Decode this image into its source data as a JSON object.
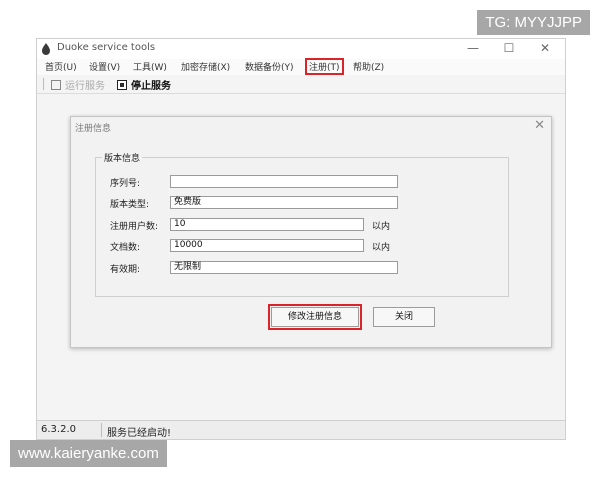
{
  "window": {
    "title": "Duoke service tools",
    "controls": {
      "minimize": "—",
      "maximize": "☐",
      "close": "✕"
    }
  },
  "menu": {
    "items": [
      {
        "label": "首页(U)"
      },
      {
        "label": "设置(V)"
      },
      {
        "label": "工具(W)"
      },
      {
        "label": "加密存储(X)"
      },
      {
        "label": "数据备份(Y)"
      },
      {
        "label": "注册(T)",
        "highlighted": true
      },
      {
        "label": "帮助(Z)"
      }
    ]
  },
  "toolbar": {
    "run_service": "运行服务",
    "stop_service": "停止服务"
  },
  "dialog": {
    "title": "注册信息",
    "close_icon": "✕",
    "group_title": "版本信息",
    "fields": {
      "serial_label": "序列号:",
      "serial_value": "",
      "edition_label": "版本类型:",
      "edition_value": "免费版",
      "users_label": "注册用户数:",
      "users_value": "10",
      "users_suffix": "以内",
      "docs_label": "文档数:",
      "docs_value": "10000",
      "docs_suffix": "以内",
      "validity_label": "有效期:",
      "validity_value": "无限制"
    },
    "buttons": {
      "modify": "修改注册信息",
      "close": "关闭"
    }
  },
  "statusbar": {
    "version": "6.3.2.0",
    "message": "服务已经启动!"
  },
  "overlays": {
    "top_right": "TG: MYYJJPP",
    "bottom_left": "www.kaieryanke.com"
  },
  "colors": {
    "highlight": "#d9252a",
    "badge": "#a7a7a7"
  }
}
